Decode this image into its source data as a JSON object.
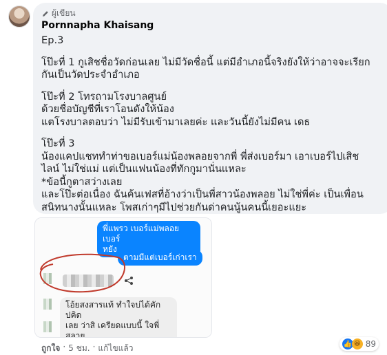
{
  "comment": {
    "author_badge": "ผู้เขียน",
    "author_name": "Pornnapha Khaisang",
    "paragraphs": [
      "Ep.3",
      "โป๊ะที่ 1 กูเสิชชื่อวัดก่อนเลย ไม่มีวัดชื่อนี้ แต่มีอำเภอนี้จริงยังให้ว่าอาจจะเรียก\nกันเป็นวัดประจำอำเภอ",
      "โป๊ะที่ 2 โทรถามโรงบาลศูนย์\nด้วยชื่อบัญชีที่เราโอนดังให้น้อง\nแตโรงบาลตอบว่า ไม่มีรับเข้ามาเลยค่ะ และวันนี้ยังไม่มีคน เดธ",
      "โป๊ะที่ 3\nน้องแคปแชททำท่าขอเบอร์แม่น้องพลอยจากพี่ พี่ส่งเบอร์มา เอาเบอร์ไปเสิช\nไลน์ ไม่ใช่แม่ แต่เป็นแฟนน้องที่ทักกูมานั่นแหละ\n*ข้อนี้กูตาสว่างเลย\nและโป๊ะต่อเนื่อง ฉันค้นเฟสที่อ้างว่าเป็นพี่สาวน้องพลอย ไม่ใช่พี่ค่ะ เป็นเพื่อน\nสนิทนางนั้นแหละ โพสเก่าๆมีไปช่วยกันด่าคนนู้นคนนี้เยอะแยะ"
    ]
  },
  "screenshot": {
    "msg_1": "พี่แพรว เบอร์แม่พลอยเบอร์\nหยัง",
    "msg_2": "ตามมีแต่เบอร์เก่าเรา",
    "msg_3": "โอ้ยสงสารแท้ ทำใจบ่ได้คัก ปคิด\nเลย ว่าสิ เครียดแบบนี้ ใจพี่สลาย\nแล้วน้อง"
  },
  "footer": {
    "like": "ถูกใจ",
    "sep": "·",
    "time": "5 ชม.",
    "edited": "แก้ไขแล้ว"
  },
  "reactions": {
    "count": "89",
    "like_color": "#1877f2",
    "haha_color": "#f7b125"
  },
  "colors": {
    "bubble": "#f0f2f5",
    "messenger_blue": "#0a84ff",
    "annotation_red": "#c0392b"
  }
}
